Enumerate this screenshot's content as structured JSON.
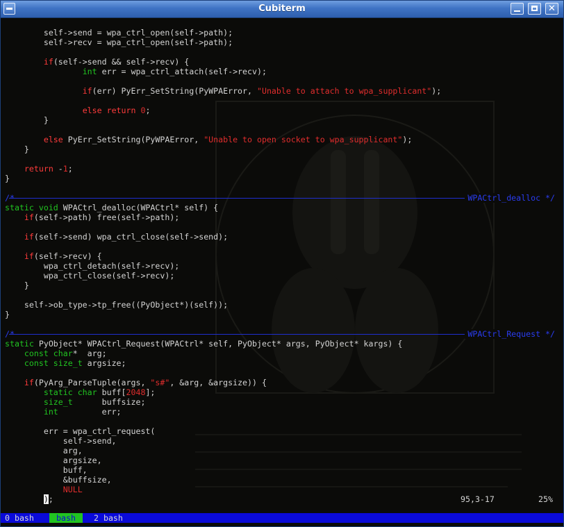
{
  "window": {
    "title": "Cubiterm",
    "close_glyph": "✕"
  },
  "editor": {
    "lines": [
      {
        "row": 1,
        "parts": [
          {
            "t": "        self->send = wpa_ctrl_open(self->path);"
          }
        ]
      },
      {
        "row": 2,
        "parts": [
          {
            "t": "        self->recv = wpa_ctrl_open(self->path);"
          }
        ]
      },
      {
        "row": 4,
        "parts": [
          {
            "t": "        "
          },
          {
            "t": "if",
            "c": "kw"
          },
          {
            "t": "(self->send && self->recv) {"
          }
        ]
      },
      {
        "row": 5,
        "parts": [
          {
            "t": "                "
          },
          {
            "t": "int",
            "c": "ty"
          },
          {
            "t": " err = wpa_ctrl_attach(self->recv);"
          }
        ]
      },
      {
        "row": 7,
        "parts": [
          {
            "t": "                "
          },
          {
            "t": "if",
            "c": "kw"
          },
          {
            "t": "(err) PyErr_SetString(PyWPAError, "
          },
          {
            "t": "\"Unable to attach to wpa_supplicant\"",
            "c": "st"
          },
          {
            "t": ");"
          }
        ]
      },
      {
        "row": 9,
        "parts": [
          {
            "t": "                "
          },
          {
            "t": "else return",
            "c": "kw"
          },
          {
            "t": " "
          },
          {
            "t": "0",
            "c": "num"
          },
          {
            "t": ";"
          }
        ]
      },
      {
        "row": 10,
        "parts": [
          {
            "t": "        }"
          }
        ]
      },
      {
        "row": 12,
        "parts": [
          {
            "t": "        "
          },
          {
            "t": "else",
            "c": "kw"
          },
          {
            "t": " PyErr_SetString(PyWPAError, "
          },
          {
            "t": "\"Unable to open socket to wpa_supplicant\"",
            "c": "st"
          },
          {
            "t": ");"
          }
        ]
      },
      {
        "row": 13,
        "parts": [
          {
            "t": "    }"
          }
        ]
      },
      {
        "row": 15,
        "parts": [
          {
            "t": "    "
          },
          {
            "t": "return",
            "c": "kw"
          },
          {
            "t": " -"
          },
          {
            "t": "1",
            "c": "num"
          },
          {
            "t": ";"
          }
        ]
      },
      {
        "row": 16,
        "parts": [
          {
            "t": "}"
          }
        ]
      },
      {
        "row": 19,
        "parts": [
          {
            "t": "static void",
            "c": "ty"
          },
          {
            "t": " WPACtrl_dealloc(WPACtrl* self) {"
          }
        ]
      },
      {
        "row": 20,
        "parts": [
          {
            "t": "    "
          },
          {
            "t": "if",
            "c": "kw"
          },
          {
            "t": "(self->path) free(self->path);"
          }
        ]
      },
      {
        "row": 22,
        "parts": [
          {
            "t": "    "
          },
          {
            "t": "if",
            "c": "kw"
          },
          {
            "t": "(self->send) wpa_ctrl_close(self->send);"
          }
        ]
      },
      {
        "row": 24,
        "parts": [
          {
            "t": "    "
          },
          {
            "t": "if",
            "c": "kw"
          },
          {
            "t": "(self->recv) {"
          }
        ]
      },
      {
        "row": 25,
        "parts": [
          {
            "t": "        wpa_ctrl_detach(self->recv);"
          }
        ]
      },
      {
        "row": 26,
        "parts": [
          {
            "t": "        wpa_ctrl_close(self->recv);"
          }
        ]
      },
      {
        "row": 27,
        "parts": [
          {
            "t": "    }"
          }
        ]
      },
      {
        "row": 29,
        "parts": [
          {
            "t": "    self->ob_type->tp_free((PyObject*)(self));"
          }
        ]
      },
      {
        "row": 30,
        "parts": [
          {
            "t": "}"
          }
        ]
      },
      {
        "row": 33,
        "parts": [
          {
            "t": "static",
            "c": "ty"
          },
          {
            "t": " PyObject* WPACtrl_Request(WPACtrl* self, PyObject* args, PyObject* kargs) {"
          }
        ]
      },
      {
        "row": 34,
        "parts": [
          {
            "t": "    "
          },
          {
            "t": "const char",
            "c": "ty"
          },
          {
            "t": "*  arg;"
          }
        ]
      },
      {
        "row": 35,
        "parts": [
          {
            "t": "    "
          },
          {
            "t": "const size_t",
            "c": "ty"
          },
          {
            "t": " argsize;"
          }
        ]
      },
      {
        "row": 37,
        "parts": [
          {
            "t": "    "
          },
          {
            "t": "if",
            "c": "kw"
          },
          {
            "t": "(PyArg_ParseTuple(args, "
          },
          {
            "t": "\"s#\"",
            "c": "st"
          },
          {
            "t": ", &arg, &argsize)) {"
          }
        ]
      },
      {
        "row": 38,
        "parts": [
          {
            "t": "        "
          },
          {
            "t": "static char",
            "c": "ty"
          },
          {
            "t": " buff["
          },
          {
            "t": "2048",
            "c": "num"
          },
          {
            "t": "];"
          }
        ]
      },
      {
        "row": 39,
        "parts": [
          {
            "t": "        "
          },
          {
            "t": "size_t",
            "c": "ty"
          },
          {
            "t": "      buffsize;"
          }
        ]
      },
      {
        "row": 40,
        "parts": [
          {
            "t": "        "
          },
          {
            "t": "int",
            "c": "ty"
          },
          {
            "t": "         err;"
          }
        ]
      },
      {
        "row": 42,
        "parts": [
          {
            "t": "        err = wpa_ctrl_request("
          }
        ]
      },
      {
        "row": 43,
        "parts": [
          {
            "t": "            self->send,"
          }
        ]
      },
      {
        "row": 44,
        "parts": [
          {
            "t": "            arg,"
          }
        ]
      },
      {
        "row": 45,
        "parts": [
          {
            "t": "            argsize,"
          }
        ]
      },
      {
        "row": 46,
        "parts": [
          {
            "t": "            buff,"
          }
        ]
      },
      {
        "row": 47,
        "parts": [
          {
            "t": "            &buffsize,"
          }
        ]
      },
      {
        "row": 48,
        "parts": [
          {
            "t": "            "
          },
          {
            "t": "NULL",
            "c": "st"
          }
        ]
      },
      {
        "row": 49,
        "parts": [
          {
            "t": "        "
          },
          {
            "t": ")",
            "c": "cursor"
          },
          {
            "t": ";"
          }
        ]
      }
    ],
    "separators": [
      {
        "row": 18,
        "star": "/*",
        "label": "WPACtrl_dealloc */"
      },
      {
        "row": 32,
        "star": "/*",
        "label": "WPACtrl_Request */"
      }
    ],
    "ruler_position": "95,3-17",
    "ruler_percent": "25%"
  },
  "statusbar": {
    "windows": [
      {
        "id": "win-0",
        "label": "0 bash"
      },
      {
        "id": "win-1",
        "label": "bash"
      },
      {
        "id": "win-2",
        "label": "2 bash"
      }
    ]
  },
  "colors": {
    "keyword": "#ff3b3b",
    "type": "#21c421",
    "string": "#e02d2d",
    "separator": "#2a3cf0",
    "statusbar": "#0a0ad8",
    "active_window": "#21c421",
    "titlebar": "#3f73c4"
  }
}
